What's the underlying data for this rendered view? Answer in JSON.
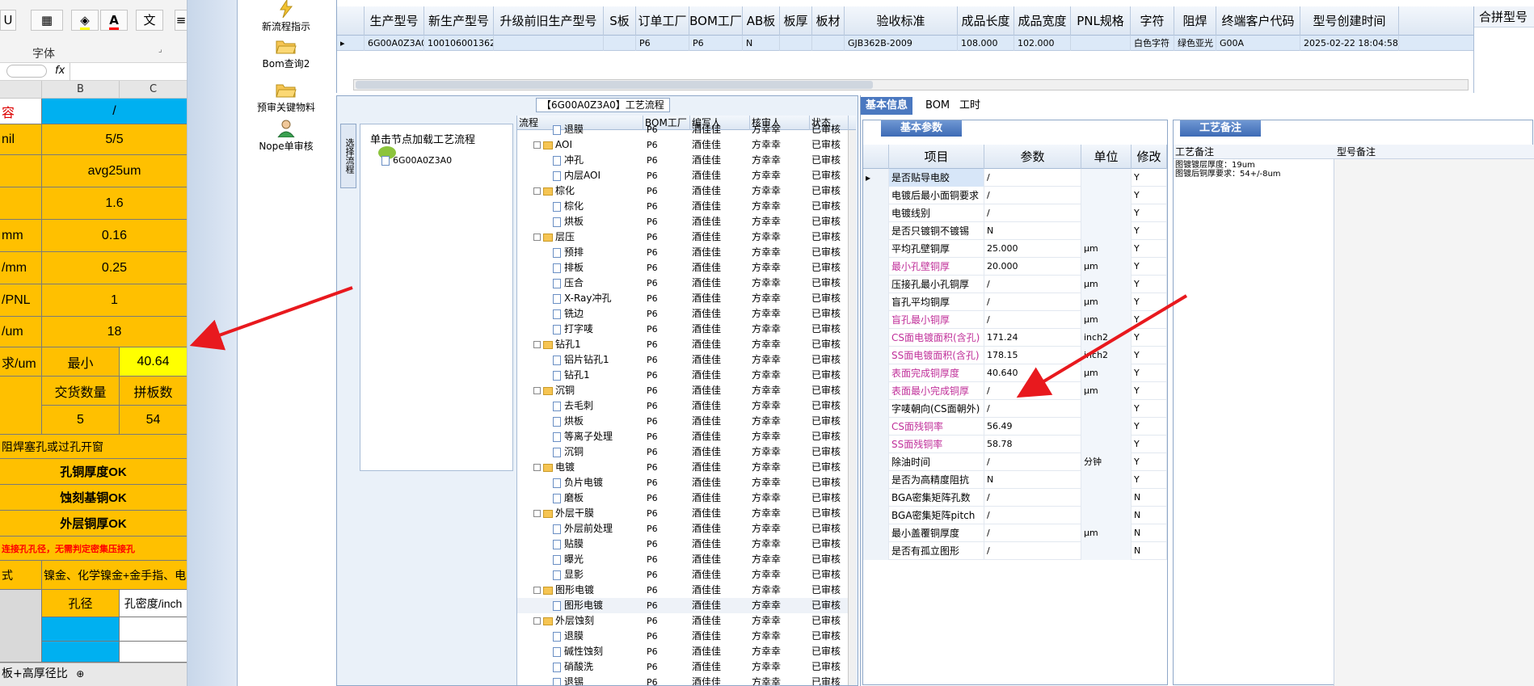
{
  "excel": {
    "font_group_label": "字体",
    "underline_btn": "U",
    "font_color_btn": "A",
    "fx_label": "fx",
    "col_b": "B",
    "col_c": "C",
    "rows": [
      {
        "a": "容",
        "b": "/",
        "c": ""
      },
      {
        "a": "nil",
        "b": "5/5",
        "c": ""
      },
      {
        "a": "",
        "b": "avg25um",
        "c": ""
      },
      {
        "a": "",
        "b": "1.6",
        "c": ""
      },
      {
        "a": "mm",
        "b": "0.16",
        "c": ""
      },
      {
        "a": "/mm",
        "b": "0.25",
        "c": ""
      },
      {
        "a": "/PNL",
        "b": "1",
        "c": ""
      },
      {
        "a": "/um",
        "b": "18",
        "c": ""
      }
    ],
    "req_label": "求/um",
    "min_label": "最小",
    "min_value": "40.64",
    "delivery_qty_label": "交货数量",
    "panel_count_label": "拼板数",
    "delivery_qty": "5",
    "panel_count": "54",
    "solder_mask_note": "阻焊塞孔或过孔开窗",
    "ok1": "孔铜厚度OK",
    "ok2": "蚀刻基铜OK",
    "ok3": "外层铜厚OK",
    "red_note": "连接孔孔径，无需判定密集压接孔",
    "surface_label": "式",
    "surface_value": "镍金、化学镍金+金手指、电",
    "hole_diameter": "孔径",
    "hole_density": "孔密度/inch",
    "sheet_tab": "板+高厚径比"
  },
  "toolbar": {
    "new_flow": "新流程指示",
    "bom_query": "Bom查询2",
    "pre_review": "预审关键物料",
    "nope_review": "Nope单审核"
  },
  "topgrid": {
    "headers": [
      "生产型号",
      "新生产型号",
      "升级前旧生产型号",
      "S板",
      "订单工厂",
      "BOM工厂",
      "AB板",
      "板厚",
      "板材",
      "验收标准",
      "成品长度",
      "成品宽度",
      "PNL规格",
      "字符",
      "阻焊",
      "终端客户代码",
      "型号创建时间"
    ],
    "row": [
      "6G00A0Z3A0",
      "10010600136202",
      "",
      "",
      "P6",
      "P6",
      "N",
      "",
      "",
      "GJB362B-2009",
      "108.000",
      "102.000",
      "",
      "白色字符",
      "绿色亚光",
      "G00A",
      "2025-02-22 18:04:58"
    ],
    "right_title": "合拼型号"
  },
  "process": {
    "title": "【6G00A0Z3A0】工艺流程",
    "vertical_tab": "选择流程",
    "hint": "单击节点加载工艺流程",
    "root_node": "6G00A0Z3A0",
    "columns": [
      "流程",
      "BOM工厂",
      "编写人",
      "核审人",
      "状态"
    ],
    "rows": [
      {
        "name": "退膜",
        "level": 2,
        "type": "doc",
        "f": "P6",
        "w": "酒佳佳",
        "r": "方幸幸",
        "s": "已审核"
      },
      {
        "name": "AOI",
        "level": 1,
        "type": "folder",
        "f": "P6",
        "w": "酒佳佳",
        "r": "方幸幸",
        "s": "已审核"
      },
      {
        "name": "冲孔",
        "level": 2,
        "type": "doc",
        "f": "P6",
        "w": "酒佳佳",
        "r": "方幸幸",
        "s": "已审核"
      },
      {
        "name": "内层AOI",
        "level": 2,
        "type": "doc",
        "f": "P6",
        "w": "酒佳佳",
        "r": "方幸幸",
        "s": "已审核"
      },
      {
        "name": "棕化",
        "level": 1,
        "type": "folder",
        "f": "P6",
        "w": "酒佳佳",
        "r": "方幸幸",
        "s": "已审核"
      },
      {
        "name": "棕化",
        "level": 2,
        "type": "doc",
        "f": "P6",
        "w": "酒佳佳",
        "r": "方幸幸",
        "s": "已审核"
      },
      {
        "name": "烘板",
        "level": 2,
        "type": "doc",
        "f": "P6",
        "w": "酒佳佳",
        "r": "方幸幸",
        "s": "已审核"
      },
      {
        "name": "层压",
        "level": 1,
        "type": "folder",
        "f": "P6",
        "w": "酒佳佳",
        "r": "方幸幸",
        "s": "已审核"
      },
      {
        "name": "预排",
        "level": 2,
        "type": "doc",
        "f": "P6",
        "w": "酒佳佳",
        "r": "方幸幸",
        "s": "已审核"
      },
      {
        "name": "排板",
        "level": 2,
        "type": "doc",
        "f": "P6",
        "w": "酒佳佳",
        "r": "方幸幸",
        "s": "已审核"
      },
      {
        "name": "压合",
        "level": 2,
        "type": "doc",
        "f": "P6",
        "w": "酒佳佳",
        "r": "方幸幸",
        "s": "已审核"
      },
      {
        "name": "X-Ray冲孔",
        "level": 2,
        "type": "doc",
        "f": "P6",
        "w": "酒佳佳",
        "r": "方幸幸",
        "s": "已审核"
      },
      {
        "name": "铣边",
        "level": 2,
        "type": "doc",
        "f": "P6",
        "w": "酒佳佳",
        "r": "方幸幸",
        "s": "已审核"
      },
      {
        "name": "打字唛",
        "level": 2,
        "type": "doc",
        "f": "P6",
        "w": "酒佳佳",
        "r": "方幸幸",
        "s": "已审核"
      },
      {
        "name": "钻孔1",
        "level": 1,
        "type": "folder",
        "f": "P6",
        "w": "酒佳佳",
        "r": "方幸幸",
        "s": "已审核"
      },
      {
        "name": "铝片钻孔1",
        "level": 2,
        "type": "doc",
        "f": "P6",
        "w": "酒佳佳",
        "r": "方幸幸",
        "s": "已审核"
      },
      {
        "name": "钻孔1",
        "level": 2,
        "type": "doc",
        "f": "P6",
        "w": "酒佳佳",
        "r": "方幸幸",
        "s": "已审核"
      },
      {
        "name": "沉铜",
        "level": 1,
        "type": "folder",
        "f": "P6",
        "w": "酒佳佳",
        "r": "方幸幸",
        "s": "已审核"
      },
      {
        "name": "去毛刺",
        "level": 2,
        "type": "doc",
        "f": "P6",
        "w": "酒佳佳",
        "r": "方幸幸",
        "s": "已审核"
      },
      {
        "name": "烘板",
        "level": 2,
        "type": "doc",
        "f": "P6",
        "w": "酒佳佳",
        "r": "方幸幸",
        "s": "已审核"
      },
      {
        "name": "等离子处理",
        "level": 2,
        "type": "doc",
        "f": "P6",
        "w": "酒佳佳",
        "r": "方幸幸",
        "s": "已审核"
      },
      {
        "name": "沉铜",
        "level": 2,
        "type": "doc",
        "f": "P6",
        "w": "酒佳佳",
        "r": "方幸幸",
        "s": "已审核"
      },
      {
        "name": "电镀",
        "level": 1,
        "type": "folder",
        "f": "P6",
        "w": "酒佳佳",
        "r": "方幸幸",
        "s": "已审核"
      },
      {
        "name": "负片电镀",
        "level": 2,
        "type": "doc",
        "f": "P6",
        "w": "酒佳佳",
        "r": "方幸幸",
        "s": "已审核"
      },
      {
        "name": "磨板",
        "level": 2,
        "type": "doc",
        "f": "P6",
        "w": "酒佳佳",
        "r": "方幸幸",
        "s": "已审核"
      },
      {
        "name": "外层干膜",
        "level": 1,
        "type": "folder",
        "f": "P6",
        "w": "酒佳佳",
        "r": "方幸幸",
        "s": "已审核"
      },
      {
        "name": "外层前处理",
        "level": 2,
        "type": "doc",
        "f": "P6",
        "w": "酒佳佳",
        "r": "方幸幸",
        "s": "已审核"
      },
      {
        "name": "贴膜",
        "level": 2,
        "type": "doc",
        "f": "P6",
        "w": "酒佳佳",
        "r": "方幸幸",
        "s": "已审核"
      },
      {
        "name": "曝光",
        "level": 2,
        "type": "doc",
        "f": "P6",
        "w": "酒佳佳",
        "r": "方幸幸",
        "s": "已审核"
      },
      {
        "name": "显影",
        "level": 2,
        "type": "doc",
        "f": "P6",
        "w": "酒佳佳",
        "r": "方幸幸",
        "s": "已审核"
      },
      {
        "name": "图形电镀",
        "level": 1,
        "type": "folder",
        "f": "P6",
        "w": "酒佳佳",
        "r": "方幸幸",
        "s": "已审核"
      },
      {
        "name": "图形电镀",
        "level": 2,
        "type": "doc",
        "f": "P6",
        "w": "酒佳佳",
        "r": "方幸幸",
        "s": "已审核",
        "sel": true
      },
      {
        "name": "外层蚀刻",
        "level": 1,
        "type": "folder",
        "f": "P6",
        "w": "酒佳佳",
        "r": "方幸幸",
        "s": "已审核"
      },
      {
        "name": "退膜",
        "level": 2,
        "type": "doc",
        "f": "P6",
        "w": "酒佳佳",
        "r": "方幸幸",
        "s": "已审核"
      },
      {
        "name": "碱性蚀刻",
        "level": 2,
        "type": "doc",
        "f": "P6",
        "w": "酒佳佳",
        "r": "方幸幸",
        "s": "已审核"
      },
      {
        "name": "硝酸洗",
        "level": 2,
        "type": "doc",
        "f": "P6",
        "w": "酒佳佳",
        "r": "方幸幸",
        "s": "已审核"
      },
      {
        "name": "退锡",
        "level": 2,
        "type": "doc",
        "f": "P6",
        "w": "酒佳佳",
        "r": "方幸幸",
        "s": "已审核"
      }
    ]
  },
  "info": {
    "tabs": [
      "基本信息",
      "BOM",
      "工时"
    ],
    "basic_params_tab": "基本参数",
    "remarks_tab": "工艺备注",
    "columns": [
      "项目",
      "参数",
      "单位",
      "修改"
    ],
    "params": [
      {
        "item": "是否贴导电胶",
        "value": "/",
        "unit": "",
        "mod": "Y",
        "pink": false,
        "sel": true
      },
      {
        "item": "电镀后最小面铜要求",
        "value": "/",
        "unit": "",
        "mod": "Y",
        "pink": false
      },
      {
        "item": "电镀线别",
        "value": "/",
        "unit": "",
        "mod": "Y",
        "pink": false
      },
      {
        "item": "是否只镀铜不镀锡",
        "value": "N",
        "unit": "",
        "mod": "Y",
        "pink": false
      },
      {
        "item": "平均孔壁铜厚",
        "value": "25.000",
        "unit": "μm",
        "mod": "Y",
        "pink": false
      },
      {
        "item": "最小孔壁铜厚",
        "value": "20.000",
        "unit": "μm",
        "mod": "Y",
        "pink": true
      },
      {
        "item": "压接孔最小孔铜厚",
        "value": "/",
        "unit": "μm",
        "mod": "Y",
        "pink": false
      },
      {
        "item": "盲孔平均铜厚",
        "value": "/",
        "unit": "μm",
        "mod": "Y",
        "pink": false
      },
      {
        "item": "盲孔最小铜厚",
        "value": "/",
        "unit": "μm",
        "mod": "Y",
        "pink": true
      },
      {
        "item": "CS面电镀面积(含孔)",
        "value": "171.24",
        "unit": "inch2",
        "mod": "Y",
        "pink": true
      },
      {
        "item": "SS面电镀面积(含孔)",
        "value": "178.15",
        "unit": "inch2",
        "mod": "Y",
        "pink": true
      },
      {
        "item": "表面完成铜厚度",
        "value": "40.640",
        "unit": "μm",
        "mod": "Y",
        "pink": true
      },
      {
        "item": "表面最小完成铜厚",
        "value": "/",
        "unit": "μm",
        "mod": "Y",
        "pink": true
      },
      {
        "item": "字唛朝向(CS面朝外)",
        "value": "/",
        "unit": "",
        "mod": "Y",
        "pink": false
      },
      {
        "item": "CS面残铜率",
        "value": "56.49",
        "unit": "",
        "mod": "Y",
        "pink": true
      },
      {
        "item": "SS面残铜率",
        "value": "58.78",
        "unit": "",
        "mod": "Y",
        "pink": true
      },
      {
        "item": "除油时间",
        "value": "/",
        "unit": "分钟",
        "mod": "Y",
        "pink": false
      },
      {
        "item": "是否为高精度阻抗",
        "value": "N",
        "unit": "",
        "mod": "Y",
        "pink": false
      },
      {
        "item": "BGA密集矩阵孔数",
        "value": "/",
        "unit": "",
        "mod": "N",
        "pink": false
      },
      {
        "item": "BGA密集矩阵pitch",
        "value": "/",
        "unit": "",
        "mod": "N",
        "pink": false
      },
      {
        "item": "最小盖覆铜厚度",
        "value": "/",
        "unit": "μm",
        "mod": "N",
        "pink": false
      },
      {
        "item": "是否有孤立图形",
        "value": "/",
        "unit": "",
        "mod": "N",
        "pink": false
      }
    ],
    "remarks_col1": "工艺备注",
    "remarks_col2": "型号备注",
    "remarks_text": "图镀镀层厚度：19um\n图镀后铜厚要求：54+/-8um"
  },
  "colors": {
    "excel_orange": "#ffc000",
    "excel_blue": "#00b0f0",
    "arrow_red": "#e8191e",
    "active_tab_blue": "#4a78c0",
    "pink_text": "#c0309a"
  }
}
